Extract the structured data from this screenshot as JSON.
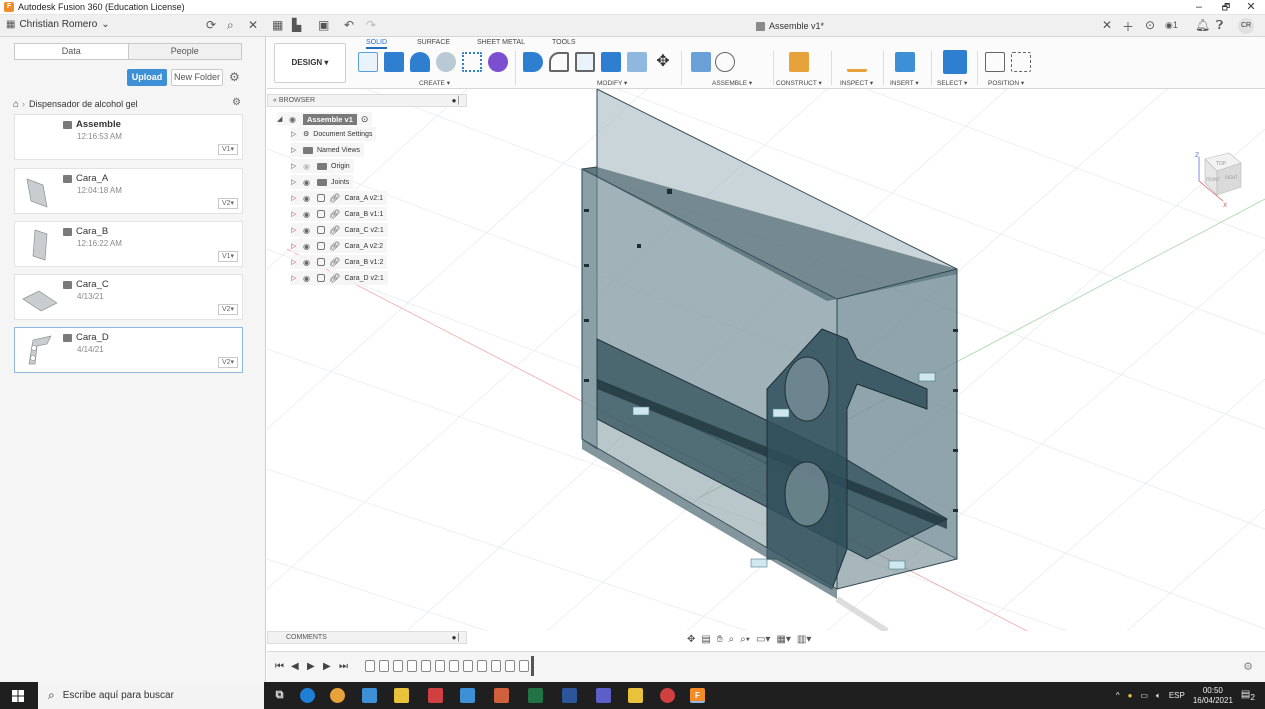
{
  "window": {
    "title": "Autodesk Fusion 360 (Education License)",
    "minimize": "–",
    "maximize": "🗗",
    "close": "✕"
  },
  "toolbar": {
    "user": "Christian Romero",
    "document_tab": "Assemble v1*",
    "right_count": "1",
    "avatar": "CR"
  },
  "data_panel": {
    "tabs": [
      "Data",
      "People"
    ],
    "upload_label": "Upload",
    "new_folder_label": "New Folder",
    "breadcrumb": "Dispensador de alcohol gel",
    "files": [
      {
        "name": "Assemble",
        "date": "12:16:53 AM",
        "version": "V1▾"
      },
      {
        "name": "Cara_A",
        "date": "12:04:18 AM",
        "version": "V2▾"
      },
      {
        "name": "Cara_B",
        "date": "12:16:22 AM",
        "version": "V1▾"
      },
      {
        "name": "Cara_C",
        "date": "4/13/21",
        "version": "V2▾"
      },
      {
        "name": "Cara_D",
        "date": "4/14/21",
        "version": "V2▾"
      }
    ]
  },
  "ribbon": {
    "workspace_label": "DESIGN ▾",
    "tabs": [
      "SOLID",
      "SURFACE",
      "SHEET METAL",
      "TOOLS"
    ],
    "groups": [
      "CREATE ▾",
      "MODIFY ▾",
      "ASSEMBLE ▾",
      "CONSTRUCT ▾",
      "INSPECT ▾",
      "INSERT ▾",
      "SELECT ▾",
      "POSITION ▾"
    ]
  },
  "browser": {
    "header": "BROWSER",
    "root": "Assemble v1",
    "items": [
      "Document Settings",
      "Named Views",
      "Origin",
      "Joints"
    ],
    "components": [
      "Cara_A v2:1",
      "Cara_B v1:1",
      "Cara_C v2:1",
      "Cara_A v2:2",
      "Cara_B v1:2",
      "Cara_D v2:1"
    ]
  },
  "comments": {
    "label": "COMMENTS"
  },
  "viewcube": {
    "top": "TOP",
    "front": "FRONT",
    "right": "RIGHT",
    "axis_z": "Z",
    "axis_x": "X"
  },
  "taskbar": {
    "search_placeholder": "Escribe aquí para buscar",
    "language": "ESP",
    "time": "00:50",
    "date": "16/04/2021",
    "notifications": "2"
  },
  "colors": {
    "accent": "#1f6dc1",
    "upload": "#3d8fd6",
    "model": "#2f4f5a"
  }
}
